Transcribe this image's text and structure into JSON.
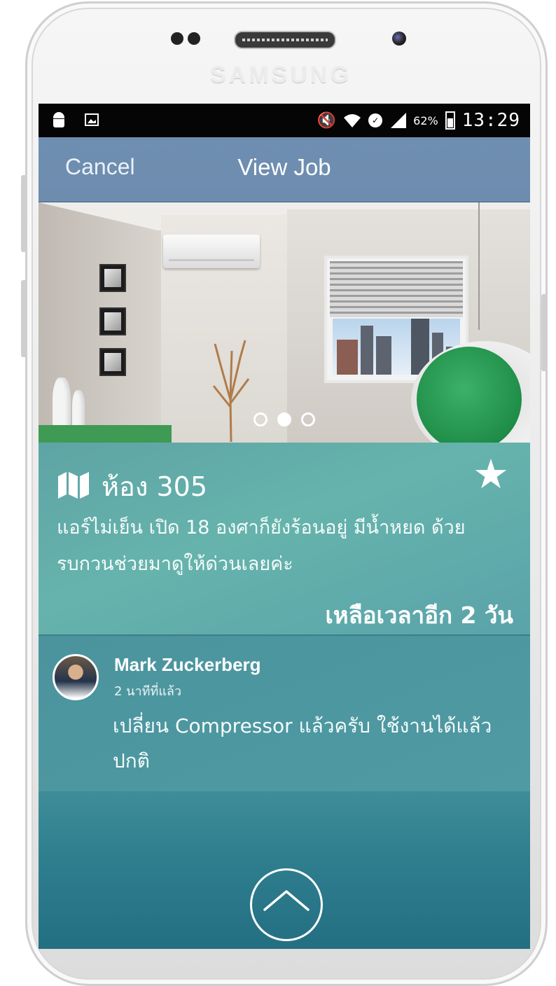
{
  "device": {
    "brand": "SAMSUNG"
  },
  "statusbar": {
    "battery": "62%",
    "time": "13:29"
  },
  "navbar": {
    "cancel": "Cancel",
    "title": "View Job"
  },
  "photo": {
    "page_count": 3,
    "active_page": 2
  },
  "job": {
    "room": "ห้อง 305",
    "description": "แอร์ไม่เย็น เปิด 18 องศาก็ยังร้อนอยู่ มีน้ำหยด ด้วยรบกวนช่วยมาดูให้ด่วนเลยค่ะ",
    "remaining": "เหลือเวลาอีก 2 วัน",
    "starred": true
  },
  "comment": {
    "author": "Mark Zuckerberg",
    "time": "2 นาทีที่แล้ว",
    "text": "เปลี่ยน Compressor แล้วครับ ใช้งานได้แล้ว ปกติ"
  },
  "icons": {
    "map": "map-icon",
    "star": "star-icon",
    "expand": "chevron-up-icon"
  }
}
